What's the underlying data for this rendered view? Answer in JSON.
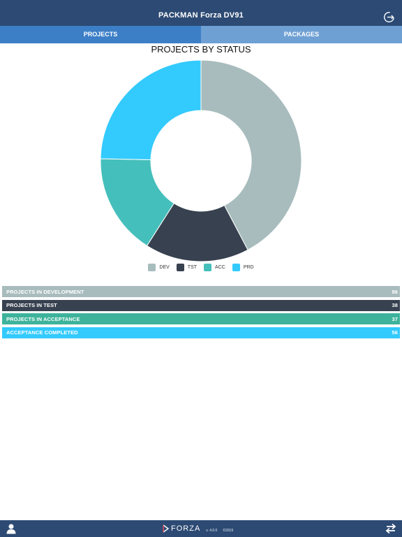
{
  "header": {
    "title": "PACKMAN Forza DV91",
    "logout_icon": "logout-icon"
  },
  "tabs": [
    {
      "label": "PROJECTS",
      "active": true
    },
    {
      "label": "PACKAGES",
      "active": false
    }
  ],
  "chart_data": {
    "type": "pie",
    "title": "PROJECTS BY STATUS",
    "categories": [
      "DEV",
      "TST",
      "ACC",
      "PRD"
    ],
    "values": [
      96,
      38,
      37,
      56
    ],
    "colors": [
      "#a8bcbd",
      "#37414f",
      "#45bfbb",
      "#33cafd"
    ],
    "donut": true,
    "legend": "bottom"
  },
  "status_rows": [
    {
      "label": "PROJECTS IN DEVELOPMENT",
      "count": "96",
      "color": "#a8bcbd"
    },
    {
      "label": "PROJECTS IN TEST",
      "count": "38",
      "color": "#37414f"
    },
    {
      "label": "PROJECTS IN ACCEPTANCE",
      "count": "37",
      "color": "#3db39b"
    },
    {
      "label": "ACCEPTANCE COMPLETED",
      "count": "56",
      "color": "#33cafd"
    }
  ],
  "footer": {
    "brand": "FORZA",
    "version": "v. 4.0.0",
    "copyright": "©2019",
    "user_icon": "user-icon",
    "swap_icon": "swap-icon"
  }
}
